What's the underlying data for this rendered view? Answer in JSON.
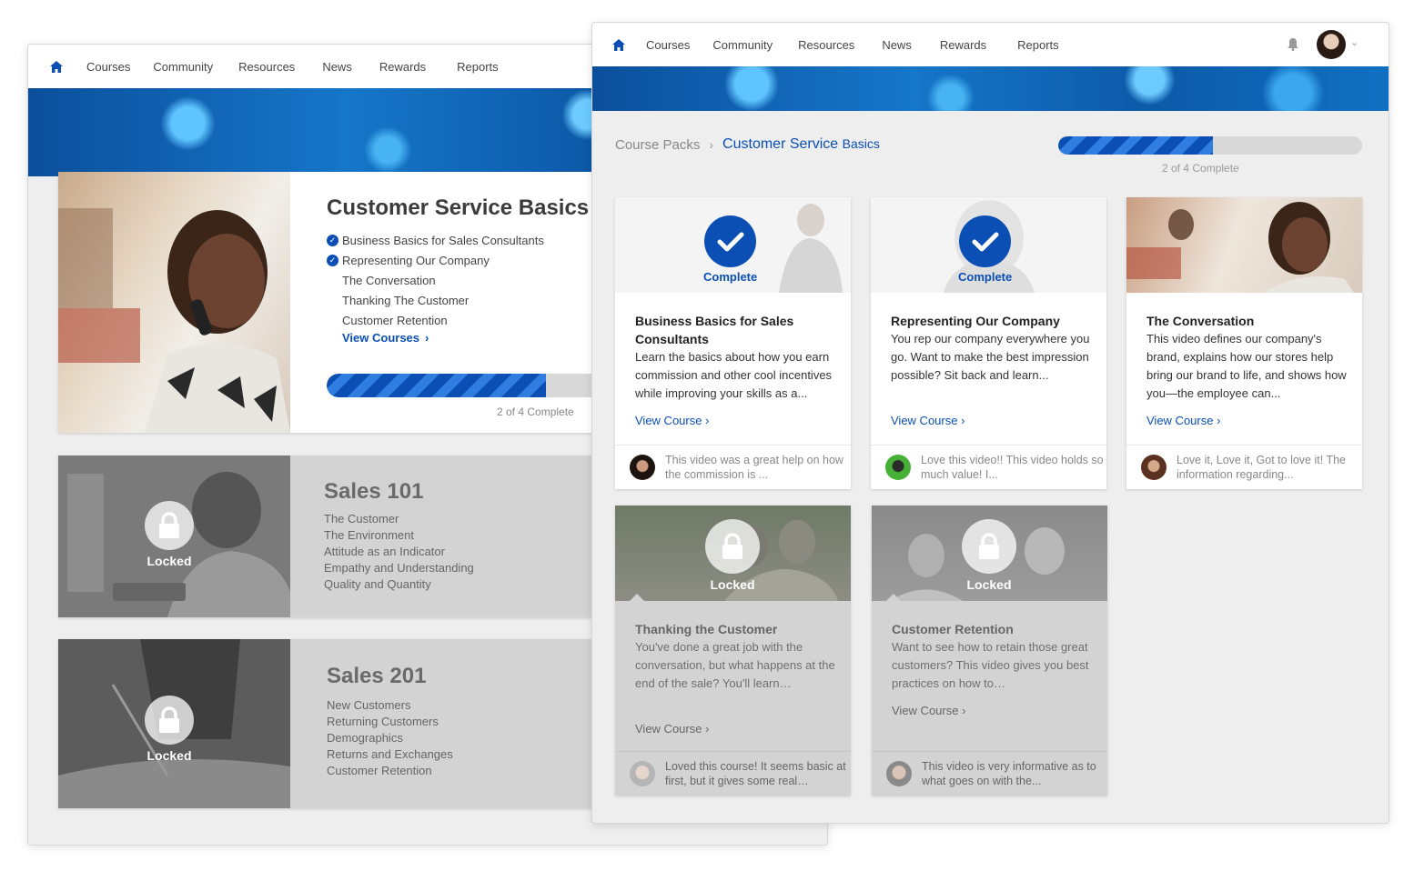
{
  "nav": {
    "items": [
      "Courses",
      "Community",
      "Resources",
      "News",
      "Rewards",
      "Reports"
    ]
  },
  "colors": {
    "accent": "#0b4fb5",
    "banner": "#1676c9",
    "locked": "#d3d3d3"
  },
  "back_window": {
    "packs": [
      {
        "title": "Customer Service Basics",
        "items": [
          {
            "label": "Business Basics for Sales Consultants",
            "done": true
          },
          {
            "label": "Representing Our Company",
            "done": true
          },
          {
            "label": "The Conversation",
            "done": false
          },
          {
            "label": "Thanking The Customer",
            "done": false
          },
          {
            "label": "Customer Retention",
            "done": false
          }
        ],
        "view_label": "View Courses",
        "progress_fraction": 0.5,
        "progress_text": "2 of 4 Complete"
      },
      {
        "title": "Sales 101",
        "locked_label": "Locked",
        "items": [
          "The Customer",
          "The Environment",
          "Attitude as an Indicator",
          "Empathy and Understanding",
          "Quality and Quantity"
        ]
      },
      {
        "title": "Sales 201",
        "locked_label": "Locked",
        "items": [
          "New Customers",
          "Returning Customers",
          "Demographics",
          "Returns and Exchanges",
          "Customer Retention"
        ]
      }
    ]
  },
  "front_window": {
    "breadcrumb": {
      "parent": "Course Packs",
      "current_a": "Customer Service",
      "current_b": "Basics"
    },
    "progress_fraction": 0.5,
    "progress_text": "2 of 4 Complete",
    "cards": [
      {
        "status": "Complete",
        "title": "Business Basics for Sales Consultants",
        "desc": "Learn the basics about how you earn commission and other cool incentives while improving your skills as a...",
        "link": "View Course",
        "comment": "This video was a great help on how the commission is ..."
      },
      {
        "status": "Complete",
        "title": "Representing Our Company",
        "desc": "You rep our company everywhere you go. Want to make the best impression possible? Sit back and learn...",
        "link": "View Course",
        "comment": "Love this video!! This video holds so much value! I..."
      },
      {
        "status": "",
        "title": "The Conversation",
        "desc": "This video defines our company's brand, explains how our stores help bring our brand to life, and shows how you—the employee can...",
        "link": "View Course",
        "comment": "Love it, Love it, Got to love it! The information regarding..."
      },
      {
        "status": "Locked",
        "title": "Thanking the Customer",
        "desc": "You've done a great job with the conversation, but what happens at the end of the sale? You'll learn…",
        "link": "View Course",
        "comment": "Loved this course! It seems basic at first, but it gives some real…"
      },
      {
        "status": "Locked",
        "title": "Customer Retention",
        "desc": "Want to see how to retain those great customers? This video gives you best practices on how to…",
        "link": "View Course",
        "comment": "This video is very informative as to what goes on with the..."
      }
    ]
  }
}
